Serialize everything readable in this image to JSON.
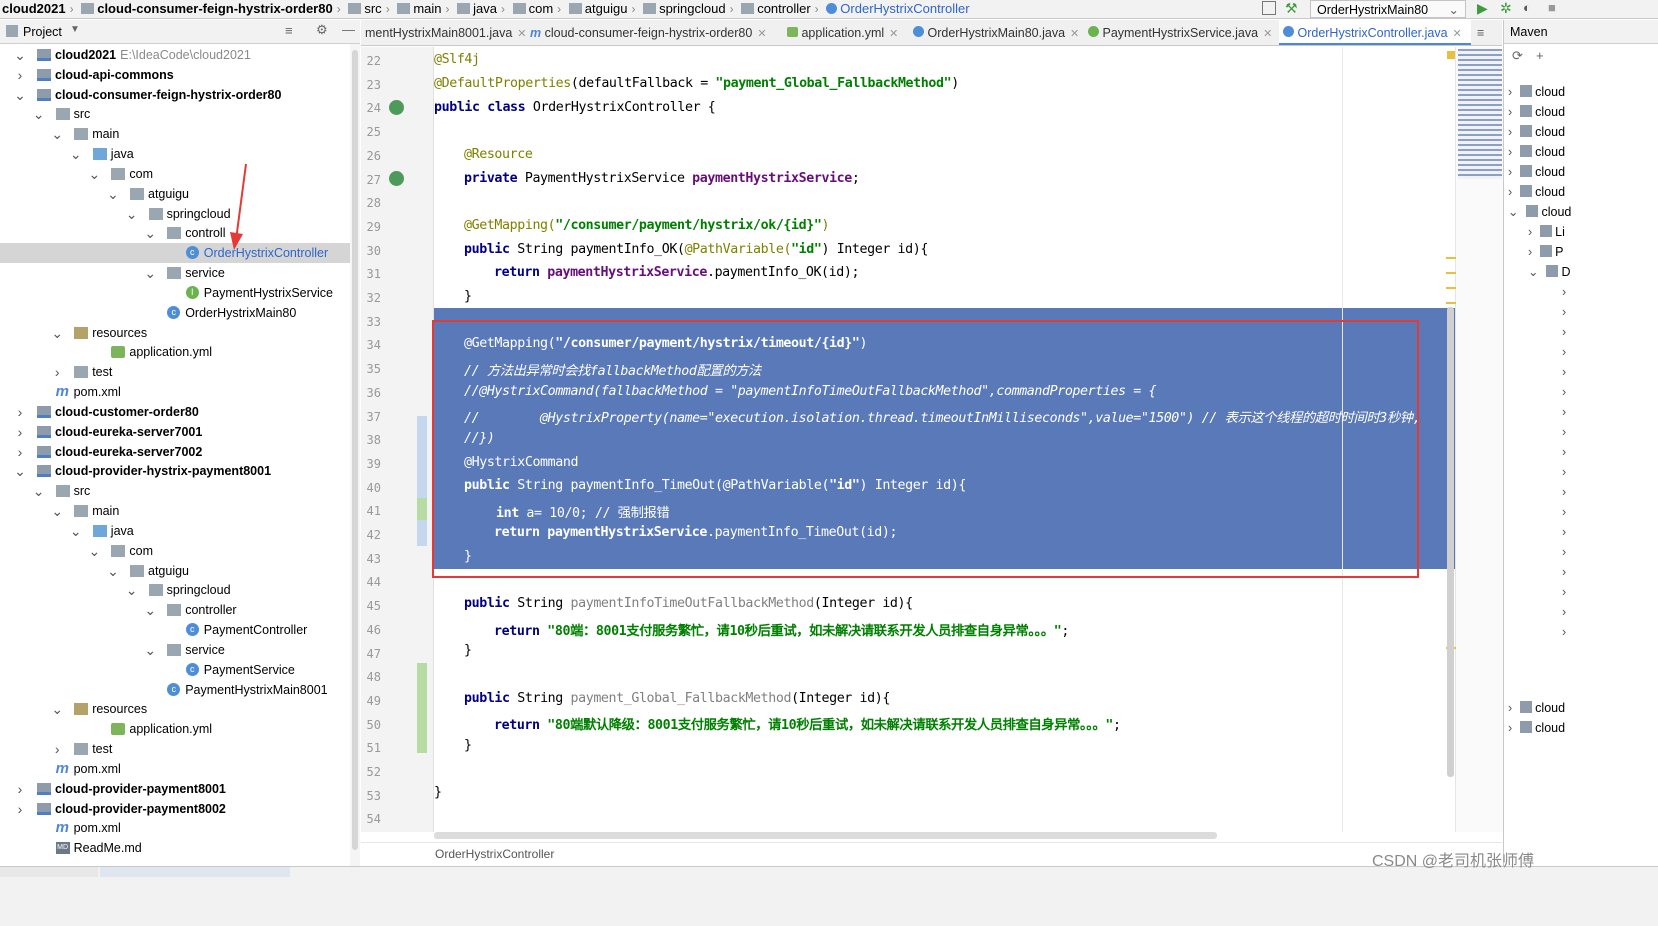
{
  "navbar": {
    "crumbs": [
      "cloud2021",
      "cloud-consumer-feign-hystrix-order80",
      "src",
      "main",
      "java",
      "com",
      "atguigu",
      "springcloud",
      "controller",
      "OrderHystrixController"
    ],
    "run_config": "OrderHystrixMain80"
  },
  "project": {
    "title": "Project",
    "rows": [
      {
        "label": "cloud2021",
        "path": "E:\\IdeaCode\\cloud2021"
      },
      {
        "label": "cloud-api-commons"
      },
      {
        "label": "cloud-consumer-feign-hystrix-order80"
      },
      {
        "label": "src"
      },
      {
        "label": "main"
      },
      {
        "label": "java"
      },
      {
        "label": "com"
      },
      {
        "label": "atguigu"
      },
      {
        "label": "springcloud"
      },
      {
        "label": "controll"
      },
      {
        "label": "OrderHystrixController"
      },
      {
        "label": "service"
      },
      {
        "label": "PaymentHystrixService"
      },
      {
        "label": "OrderHystrixMain80"
      },
      {
        "label": "resources"
      },
      {
        "label": "application.yml"
      },
      {
        "label": "test"
      },
      {
        "label": "pom.xml"
      },
      {
        "label": "cloud-customer-order80"
      },
      {
        "label": "cloud-eureka-server7001"
      },
      {
        "label": "cloud-eureka-server7002"
      },
      {
        "label": "cloud-provider-hystrix-payment8001"
      },
      {
        "label": "src"
      },
      {
        "label": "main"
      },
      {
        "label": "java"
      },
      {
        "label": "com"
      },
      {
        "label": "atguigu"
      },
      {
        "label": "springcloud"
      },
      {
        "label": "controller"
      },
      {
        "label": "PaymentController"
      },
      {
        "label": "service"
      },
      {
        "label": "PaymentService"
      },
      {
        "label": "PaymentHystrixMain8001"
      },
      {
        "label": "resources"
      },
      {
        "label": "application.yml"
      },
      {
        "label": "test"
      },
      {
        "label": "pom.xml"
      },
      {
        "label": "cloud-provider-payment8001"
      },
      {
        "label": "cloud-provider-payment8002"
      },
      {
        "label": "pom.xml"
      },
      {
        "label": "ReadMe.md"
      }
    ]
  },
  "tabs": [
    {
      "label": "mentHystrixMain8001.java"
    },
    {
      "label": "cloud-consumer-feign-hystrix-order80"
    },
    {
      "label": "application.yml"
    },
    {
      "label": "OrderHystrixMain80.java"
    },
    {
      "label": "PaymentHystrixService.java"
    },
    {
      "label": "OrderHystrixController.java"
    }
  ],
  "editor": {
    "line_numbers": [
      "22",
      "23",
      "24",
      "25",
      "26",
      "27",
      "28",
      "29",
      "30",
      "31",
      "32",
      "33",
      "34",
      "35",
      "36",
      "37",
      "38",
      "39",
      "40",
      "41",
      "42",
      "43",
      "44",
      "45",
      "46",
      "47",
      "48",
      "49",
      "50",
      "51",
      "52",
      "53",
      "54"
    ],
    "lines": {
      "l22": "@Slf4j",
      "l23a": "@DefaultProperties",
      "l23b": "(defaultFallback = ",
      "l23c": "\"payment_Global_FallbackMethod\"",
      "l23d": ")",
      "l24a": "public class ",
      "l24b": "OrderHystrixController {",
      "l26": "@Resource",
      "l27a": "private ",
      "l27b": "PaymentHystrixService ",
      "l27c": "paymentHystrixService",
      "l27d": ";",
      "l29a": "@GetMapping(",
      "l29b": "\"/consumer/payment/hystrix/ok/{id}\"",
      "l29c": ")",
      "l30a": "public ",
      "l30b": "String paymentInfo_OK(",
      "l30c": "@PathVariable(",
      "l30d": "\"id\"",
      "l30e": ") Integer id){",
      "l31a": "return ",
      "l31b": "paymentHystrixService",
      "l31c": ".paymentInfo_OK(id);",
      "l32": "}",
      "l34a": "@GetMapping(",
      "l34b": "\"/consumer/payment/hystrix/timeout/{id}\"",
      "l34c": ")",
      "l35": "// 方法出异常时会找fallbackMethod配置的方法",
      "l36": "//@HystrixCommand(fallbackMethod = \"paymentInfoTimeOutFallbackMethod\",commandProperties = {",
      "l37": "//        @HystrixProperty(name=\"execution.isolation.thread.timeoutInMilliseconds\",value=\"1500\") // 表示这个线程的超时时间时3秒钟,",
      "l38": "//})",
      "l39": "@HystrixCommand",
      "l40a": "public ",
      "l40b": "String paymentInfo_TimeOut(@PathVariable(",
      "l40c": "\"id\"",
      "l40d": ") Integer id){",
      "l41a": "int ",
      "l41b": "a= 10/0; // 强制报错",
      "l42a": "return ",
      "l42b": "paymentHystrixService",
      "l42c": ".paymentInfo_TimeOut(id);",
      "l43": "}",
      "l45a": "public ",
      "l45b": "String ",
      "l45c": "paymentInfoTimeOutFallbackMethod",
      "l45d": "(Integer id){",
      "l46a": "return ",
      "l46b": "\"80端：8001支付服务繁忙，请10秒后重试，如未解决请联系开发人员排查自身异常。。。\"",
      "l46c": ";",
      "l47": "}",
      "l49a": "public ",
      "l49b": "String ",
      "l49c": "payment_Global_FallbackMethod",
      "l49d": "(Integer id){",
      "l50a": "return ",
      "l50b": "\"80端默认降级：8001支付服务繁忙，请10秒后重试，如未解决请联系开发人员排查自身异常。。。\"",
      "l50c": ";",
      "l51": "}",
      "l53": "}"
    },
    "status_file": "OrderHystrixController"
  },
  "maven": {
    "title": "Maven",
    "items": [
      "cloud",
      "cloud",
      "cloud",
      "cloud",
      "cloud",
      "cloud",
      "cloud",
      "Li",
      "P",
      "D",
      "cloud",
      "cloud"
    ]
  },
  "watermark": "CSDN @老司机张师傅",
  "colors": {
    "selection": "#5a79b8",
    "highlight_box": "#e53935",
    "accent": "#2f65ca"
  }
}
